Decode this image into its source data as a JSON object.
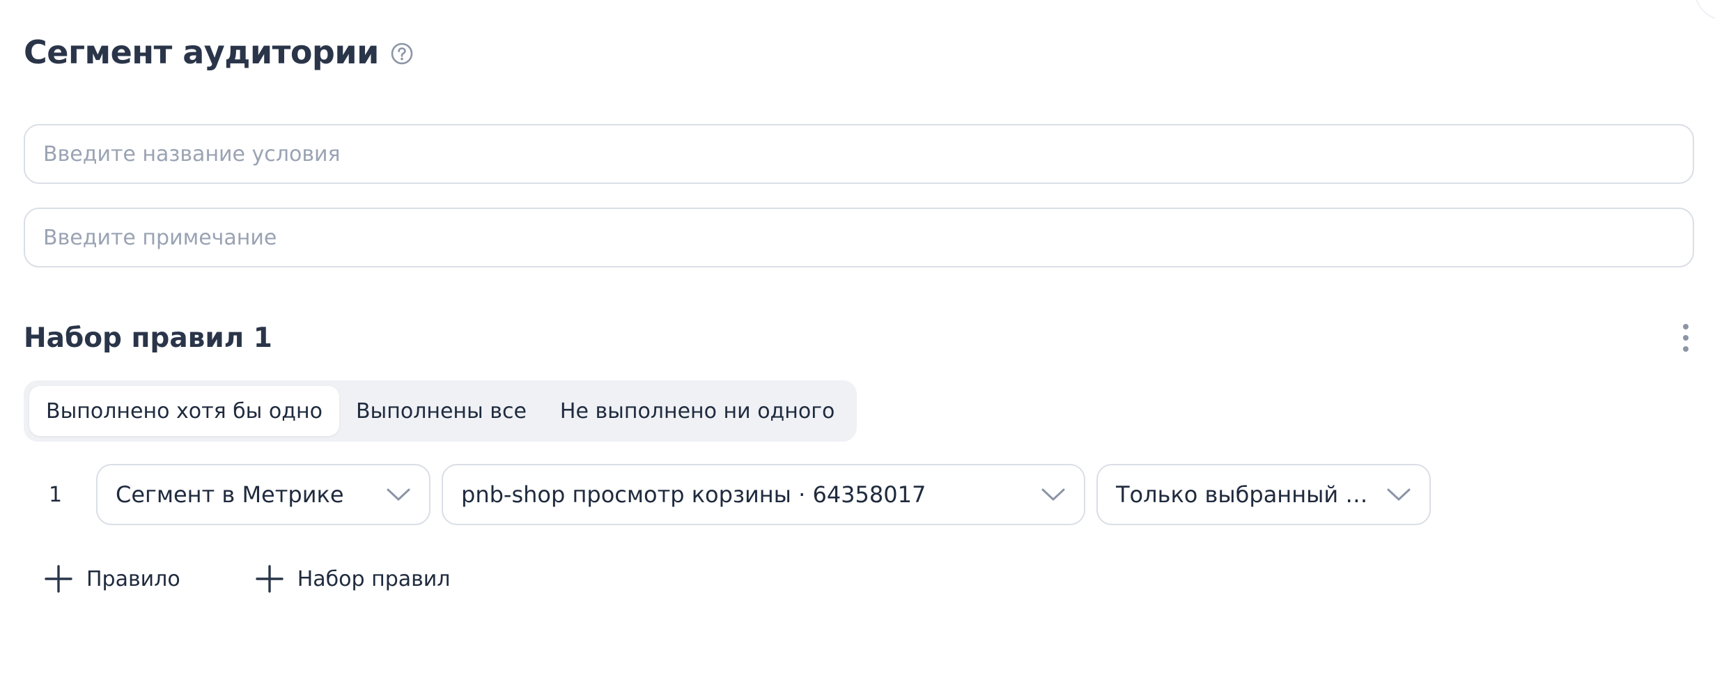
{
  "header": {
    "title": "Сегмент аудитории",
    "help_icon": "question-circle-icon"
  },
  "form": {
    "name_placeholder": "Введите название условия",
    "name_value": "",
    "note_placeholder": "Введите примечание",
    "note_value": ""
  },
  "ruleset": {
    "title": "Набор правил 1",
    "menu_icon": "vertical-dots-icon",
    "modes": [
      {
        "label": "Выполнено хотя бы одно",
        "active": true
      },
      {
        "label": "Выполнены все",
        "active": false
      },
      {
        "label": "Не выполнено ни одного",
        "active": false
      }
    ],
    "rules": [
      {
        "index": "1",
        "type": "Сегмент в Метрике",
        "segment": "pnb-shop просмотр корзины · 64358017",
        "mode": "Только выбранный сег..."
      }
    ]
  },
  "actions": {
    "add_rule": "Правило",
    "add_ruleset": "Набор правил",
    "icon": "plus-icon"
  },
  "colors": {
    "text": "#1f2a3d",
    "title": "#2a3549",
    "placeholder": "#9aa3b3",
    "border": "#dadee6",
    "segmented_bg": "#eff1f5",
    "icon_gray": "#8c95a6"
  }
}
